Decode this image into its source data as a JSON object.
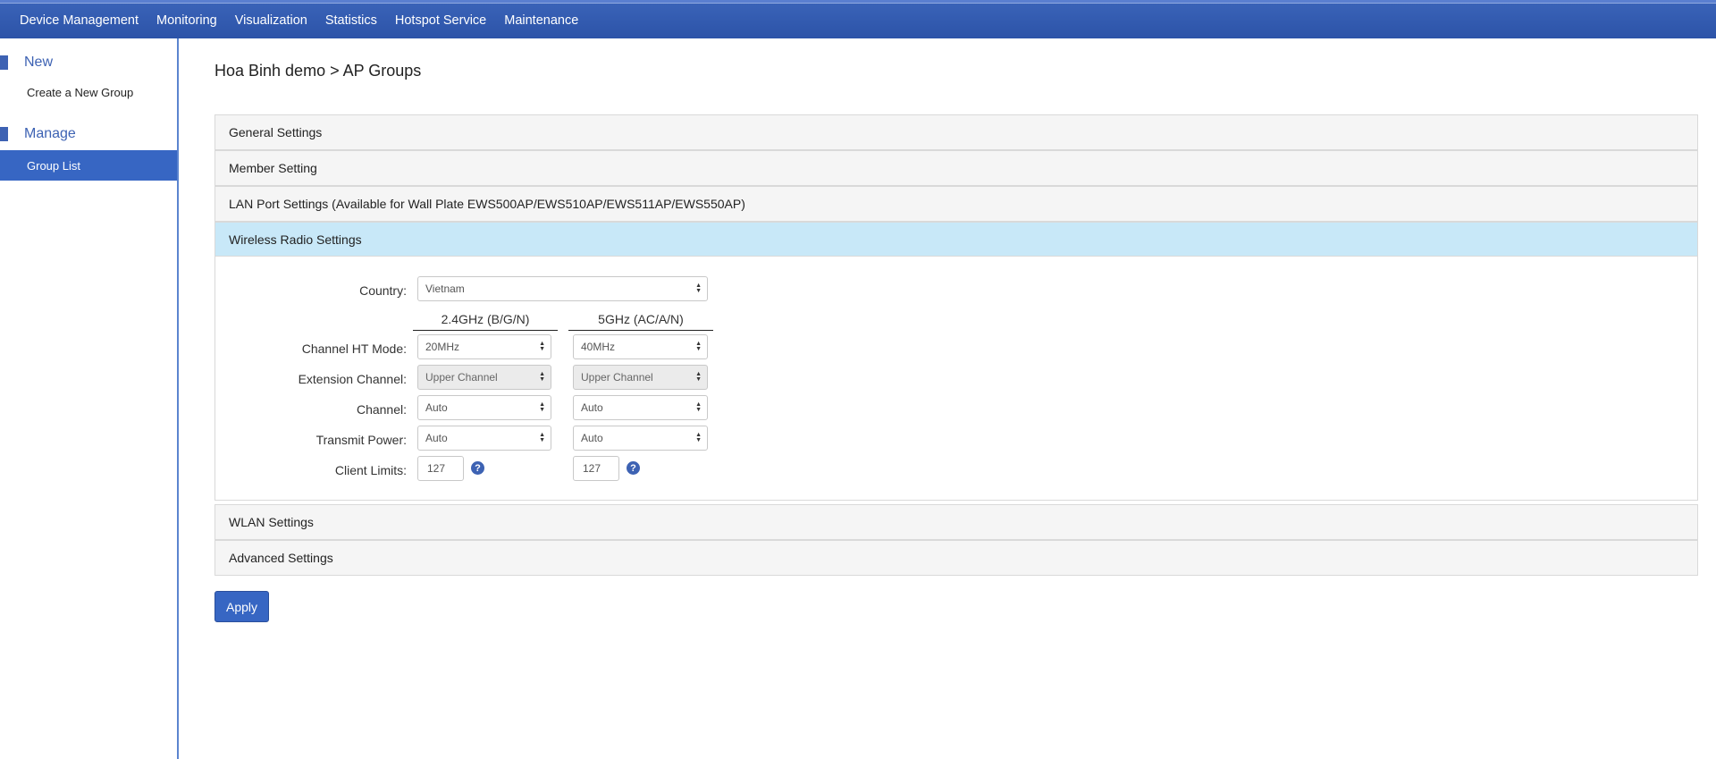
{
  "nav": {
    "items": [
      "Device Management",
      "Monitoring",
      "Visualization",
      "Statistics",
      "Hotspot Service",
      "Maintenance"
    ]
  },
  "sidebar": {
    "new_header": "New",
    "new_link": "Create a New Group",
    "manage_header": "Manage",
    "manage_link": "Group List"
  },
  "page": {
    "title": "Hoa Binh demo > AP Groups"
  },
  "panels": {
    "general": "General Settings",
    "member": "Member Setting",
    "lan": "LAN Port Settings (Available for Wall Plate EWS500AP/EWS510AP/EWS511AP/EWS550AP)",
    "wireless": "Wireless Radio Settings",
    "wlan": "WLAN Settings",
    "advanced": "Advanced Settings"
  },
  "wireless": {
    "country_label": "Country:",
    "country_value": "Vietnam",
    "col_24": "2.4GHz (B/G/N)",
    "col_5": "5GHz (AC/A/N)",
    "ht_mode_label": "Channel HT Mode:",
    "ht_mode_24": "20MHz",
    "ht_mode_5": "40MHz",
    "ext_channel_label": "Extension Channel:",
    "ext_channel_24": "Upper Channel",
    "ext_channel_5": "Upper Channel",
    "channel_label": "Channel:",
    "channel_24": "Auto",
    "channel_5": "Auto",
    "power_label": "Transmit Power:",
    "power_24": "Auto",
    "power_5": "Auto",
    "client_label": "Client Limits:",
    "client_24": "127",
    "client_5": "127"
  },
  "actions": {
    "apply": "Apply"
  },
  "colors": {
    "topbar": "#2c53a8",
    "accent": "#3766c3",
    "open_panel_head": "#c8e8f8"
  }
}
